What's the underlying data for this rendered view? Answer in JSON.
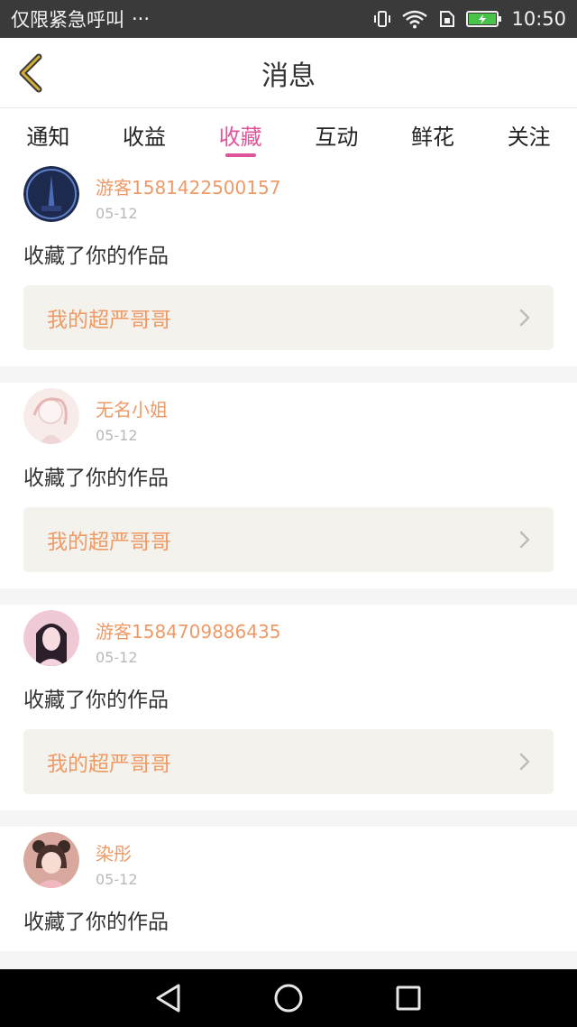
{
  "status_bar": {
    "carrier_text": "仅限紧急呼叫",
    "more": "···",
    "time": "10:50",
    "icons": [
      "vibrate-icon",
      "wifi-icon",
      "sim-icon",
      "battery-charging-icon"
    ]
  },
  "header": {
    "title": "消息",
    "back_icon": "chevron-left-icon"
  },
  "tabs": [
    {
      "label": "通知",
      "active": false
    },
    {
      "label": "收益",
      "active": false
    },
    {
      "label": "收藏",
      "active": true
    },
    {
      "label": "互动",
      "active": false
    },
    {
      "label": "鲜花",
      "active": false
    },
    {
      "label": "关注",
      "active": false
    }
  ],
  "feed": [
    {
      "user": "游客1581422500157",
      "date": "05-12",
      "action": "收藏了你的作品",
      "work": "我的超严哥哥",
      "avatar_color": "#1d2a4e"
    },
    {
      "user": "无名小姐",
      "date": "05-12",
      "action": "收藏了你的作品",
      "work": "我的超严哥哥",
      "avatar_color": "#f6e6e6"
    },
    {
      "user": "游客1584709886435",
      "date": "05-12",
      "action": "收藏了你的作品",
      "work": "我的超严哥哥",
      "avatar_color": "#e8c3cf"
    },
    {
      "user": "染彤",
      "date": "05-12",
      "action": "收藏了你的作品",
      "work": "",
      "avatar_color": "#c98f86"
    }
  ],
  "colors": {
    "accent": "#e0559a",
    "name": "#ee9a67",
    "work_bg": "#f4f2ec",
    "back_icon": "#d4b135"
  }
}
